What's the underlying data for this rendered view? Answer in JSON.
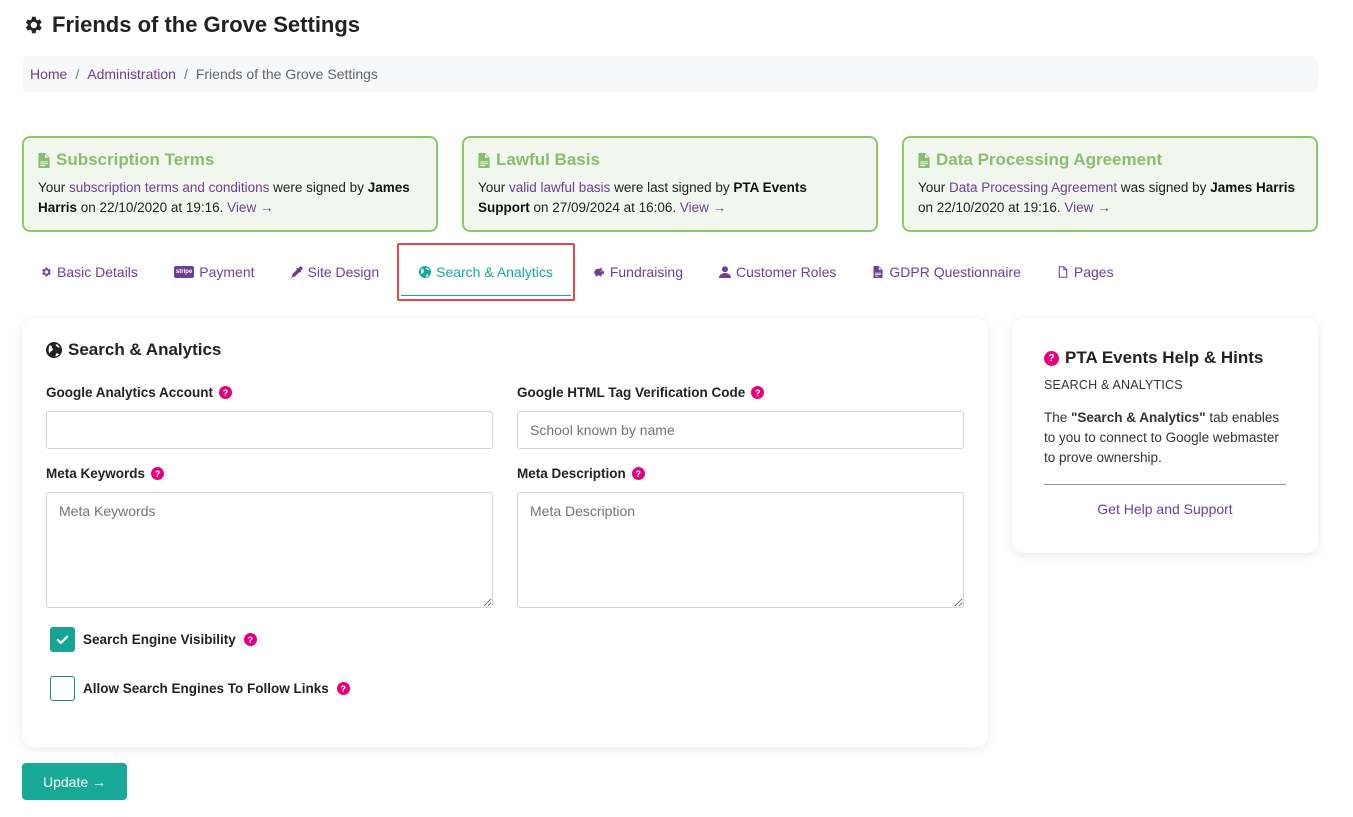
{
  "page": {
    "title": "Friends of the Grove Settings"
  },
  "breadcrumb": {
    "home": "Home",
    "admin": "Administration",
    "current": "Friends of the Grove Settings",
    "separator": "/"
  },
  "cards": [
    {
      "title": "Subscription Terms",
      "pre": "Your ",
      "link": "subscription terms and conditions",
      "mid": " were signed by ",
      "who": "James Harris",
      "post": " on 22/10/2020 at 19:16. ",
      "view": "View →"
    },
    {
      "title": "Lawful Basis",
      "pre": "Your ",
      "link": "valid lawful basis",
      "mid": " were last signed by ",
      "who": "PTA Events Support",
      "post": " on 27/09/2024 at 16:06. ",
      "view": "View →"
    },
    {
      "title": "Data Processing Agreement",
      "pre": "Your ",
      "link": "Data Processing Agreement",
      "mid": " was signed by ",
      "who": "James Harris",
      "post": " on 22/10/2020 at 19:16. ",
      "view": "View →"
    }
  ],
  "tabs": {
    "basic_details": "Basic Details",
    "payment": "Payment",
    "payment_badge": "stripe",
    "site_design": "Site Design",
    "search_analytics": "Search & Analytics",
    "fundraising": "Fundraising",
    "customer_roles": "Customer Roles",
    "gdpr": "GDPR Questionnaire",
    "pages": "Pages"
  },
  "form": {
    "section_title": "Search & Analytics",
    "ga_label": "Google Analytics Account",
    "ga_value": "",
    "tag_label": "Google HTML Tag Verification Code",
    "tag_placeholder": "School known by name",
    "keywords_label": "Meta Keywords",
    "keywords_placeholder": "Meta Keywords",
    "description_label": "Meta Description",
    "description_placeholder": "Meta Description",
    "visibility_label": "Search Engine Visibility",
    "visibility_checked": true,
    "follow_label": "Allow Search Engines To Follow Links",
    "follow_checked": false,
    "help_glyph": "?"
  },
  "help": {
    "title": "PTA Events Help & Hints",
    "subtitle": "SEARCH & ANALYTICS",
    "body_pre": "The ",
    "body_bold": "\"Search & Analytics\"",
    "body_post": " tab enables to you to connect to Google webmaster to prove ownership.",
    "link": "Get Help and Support"
  },
  "update_button": "Update →",
  "colors": {
    "accent": "#17a896",
    "brand_link": "#6f3f8f",
    "help_dot": "#e6007e",
    "card_green": "#8ac96a",
    "active_tab_highlight": "#e0474c"
  }
}
